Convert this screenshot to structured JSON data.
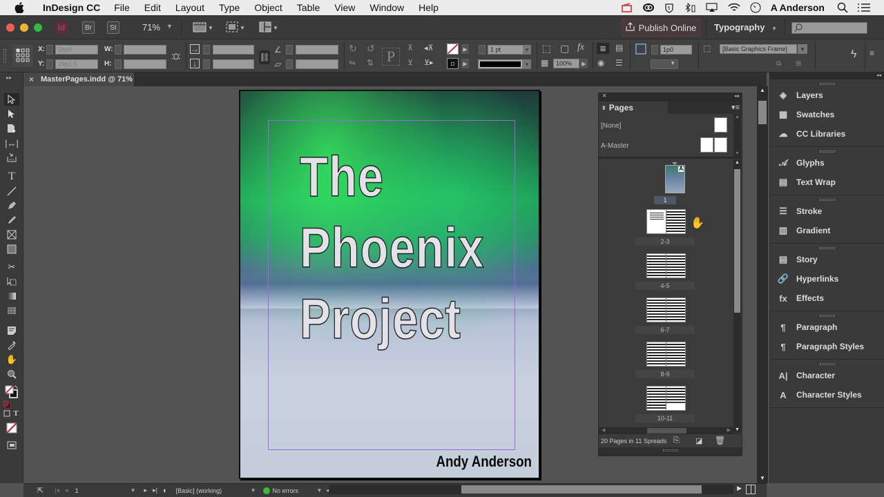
{
  "menubar": {
    "app_name": "InDesign CC",
    "items": [
      "File",
      "Edit",
      "Layout",
      "Type",
      "Object",
      "Table",
      "View",
      "Window",
      "Help"
    ],
    "user": "A Anderson",
    "status_icons": [
      "adobe-notification-icon",
      "creative-cloud-icon",
      "shield-icon",
      "bluetooth-battery-icon",
      "airplay-icon",
      "wifi-icon",
      "time-machine-icon"
    ]
  },
  "appbar": {
    "app_badge": "Id",
    "bridge_label": "Br",
    "stock_label": "St",
    "zoom_value": "71%",
    "publish_label": "Publish Online",
    "workspace": "Typography",
    "search_placeholder": ""
  },
  "control_panel": {
    "x_label": "X:",
    "x_value": "58p0",
    "y_label": "Y:",
    "y_value": "19p1.5",
    "w_label": "W:",
    "w_value": "",
    "h_label": "H:",
    "h_value": "",
    "stroke_weight": "1 pt",
    "opacity": "100%",
    "frame_offset": "1p0",
    "object_style": "[Basic Graphics Frame]"
  },
  "document_tab": {
    "title": "MasterPages.indd @ 71%"
  },
  "cover": {
    "title_lines": [
      "The",
      "Phoenix",
      "Project"
    ],
    "author": "Andy Anderson",
    "accent_margin_color": "#9a6ad8"
  },
  "pages_panel": {
    "tab_label": "Pages",
    "masters": [
      {
        "name": "[None]"
      },
      {
        "name": "A-Master"
      }
    ],
    "spreads": [
      {
        "label": "1",
        "selected": true
      },
      {
        "label": "2-3"
      },
      {
        "label": "4-5"
      },
      {
        "label": "6-7"
      },
      {
        "label": "8-9"
      },
      {
        "label": "10-11"
      }
    ],
    "master_badge": "A",
    "footer_text": "20 Pages in 11 Spreads"
  },
  "dock": {
    "groups": [
      [
        {
          "label": "Layers",
          "icon": "layers-icon"
        },
        {
          "label": "Swatches",
          "icon": "swatches-icon"
        },
        {
          "label": "CC Libraries",
          "icon": "cc-libraries-icon"
        }
      ],
      [
        {
          "label": "Glyphs",
          "icon": "glyphs-icon"
        },
        {
          "label": "Text Wrap",
          "icon": "text-wrap-icon"
        }
      ],
      [
        {
          "label": "Stroke",
          "icon": "stroke-icon"
        },
        {
          "label": "Gradient",
          "icon": "gradient-icon"
        }
      ],
      [
        {
          "label": "Story",
          "icon": "story-icon"
        },
        {
          "label": "Hyperlinks",
          "icon": "hyperlinks-icon"
        },
        {
          "label": "Effects",
          "icon": "effects-icon"
        }
      ],
      [
        {
          "label": "Paragraph",
          "icon": "paragraph-icon"
        },
        {
          "label": "Paragraph Styles",
          "icon": "paragraph-styles-icon"
        }
      ],
      [
        {
          "label": "Character",
          "icon": "character-icon"
        },
        {
          "label": "Character Styles",
          "icon": "character-styles-icon"
        }
      ]
    ]
  },
  "status_bar": {
    "page_number": "1",
    "preflight_profile": "[Basic] (working)",
    "errors": "No errors",
    "ok_color": "#3cb83c"
  }
}
